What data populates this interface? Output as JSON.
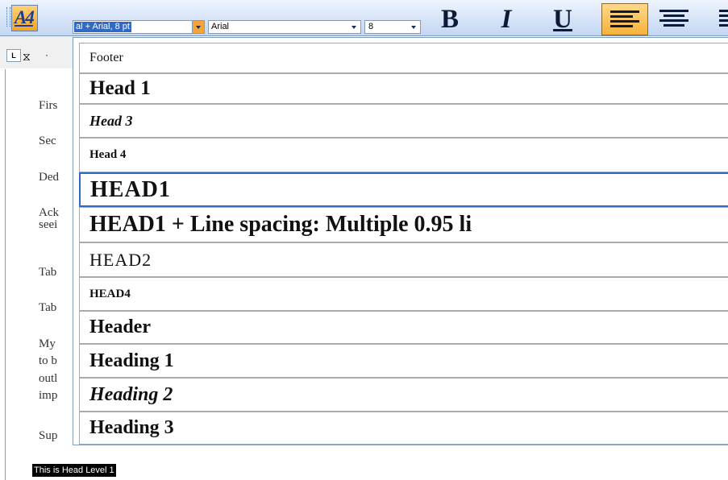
{
  "toolbar": {
    "styles_button_glyph": "A4",
    "style_box_value": "al + Arial, 8 pt",
    "font_box_value": "Arial",
    "size_box_value": "8",
    "bold_label": "B",
    "italic_label": "I",
    "underline_label": "U"
  },
  "ruler": {
    "tab_stop_glyph": "L",
    "hourglass_glyph": "⧖",
    "dot": "·"
  },
  "document": {
    "fragments": [
      "Firs",
      "Sec",
      "Ded",
      "Ack",
      "seei",
      "Tab",
      "Tab",
      "My",
      "to b",
      "outl",
      "imp",
      "Sup"
    ],
    "highlighted": "This is Head Level 1"
  },
  "style_list": {
    "items": [
      {
        "label": "Footer"
      },
      {
        "label": "Head 1"
      },
      {
        "label": "Head 3"
      },
      {
        "label": "Head 4"
      },
      {
        "label": "HEAD1"
      },
      {
        "label": "HEAD1 + Line spacing:  Multiple 0.95 li"
      },
      {
        "label": "HEAD2"
      },
      {
        "label": "HEAD4"
      },
      {
        "label": "Header"
      },
      {
        "label": "Heading 1"
      },
      {
        "label": "Heading 2"
      },
      {
        "label": "Heading 3"
      }
    ],
    "selected_item": "HEAD1"
  },
  "colors": {
    "selection": "#316ac5",
    "toolbar_gradient_top": "#eef4fd",
    "toolbar_gradient_bottom": "#c3d6f3",
    "active_button": "#f7b23b"
  }
}
